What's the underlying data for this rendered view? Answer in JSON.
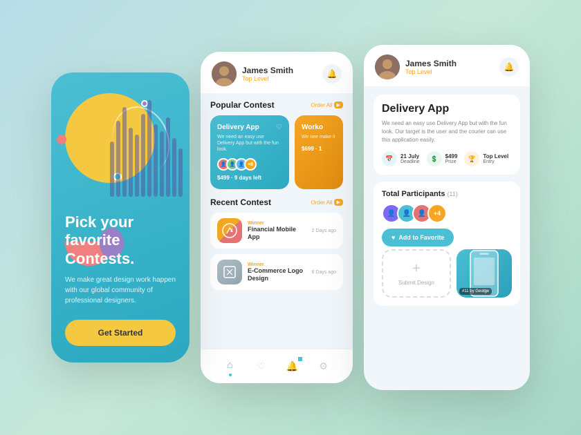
{
  "screen_intro": {
    "title_line1": "Pick your favorite",
    "title_line2": "Contests.",
    "subtitle": "We make great design work happen with our global community of professional designers.",
    "btn_label": "Get Started"
  },
  "screen_list": {
    "user_name": "James Smith",
    "user_level": "Top Level",
    "popular_section": "Popular Contest",
    "popular_link": "Order All",
    "card1_title": "Delivery App",
    "card1_desc": "We need an easy use Delivery App but with the fun look.",
    "card1_price": "$499 · 9 days left",
    "card2_title": "Worko",
    "card2_desc": "We nee make it",
    "card2_price": "$699 · 1",
    "recent_section": "Recent Contest",
    "recent_link": "Order All",
    "recent1_winner": "Winner",
    "recent1_title": "Financial Mobile App",
    "recent1_date": "2 Days ago",
    "recent2_winner": "Winner",
    "recent2_title": "E-Commerce Logo Design",
    "recent2_date": "6 Days ago",
    "avatar_extra": "+8"
  },
  "screen_detail": {
    "user_name": "James Smith",
    "user_level": "Top Level",
    "app_title": "Delivery App",
    "app_desc": "We need an easy use Delivery App but with the fun look. Our target is the user and the courier can use this application easily.",
    "stat1_label": "Deadline",
    "stat1_value": "21 July",
    "stat2_label": "Prize",
    "stat2_value": "$499",
    "stat3_label": "Entry",
    "stat3_value": "Top Level",
    "participants_label": "Total Participants",
    "participants_count": "(11)",
    "fav_btn": "Add to Favorite",
    "submit_label": "Submit Design",
    "preview_badge": "#11 by George"
  }
}
